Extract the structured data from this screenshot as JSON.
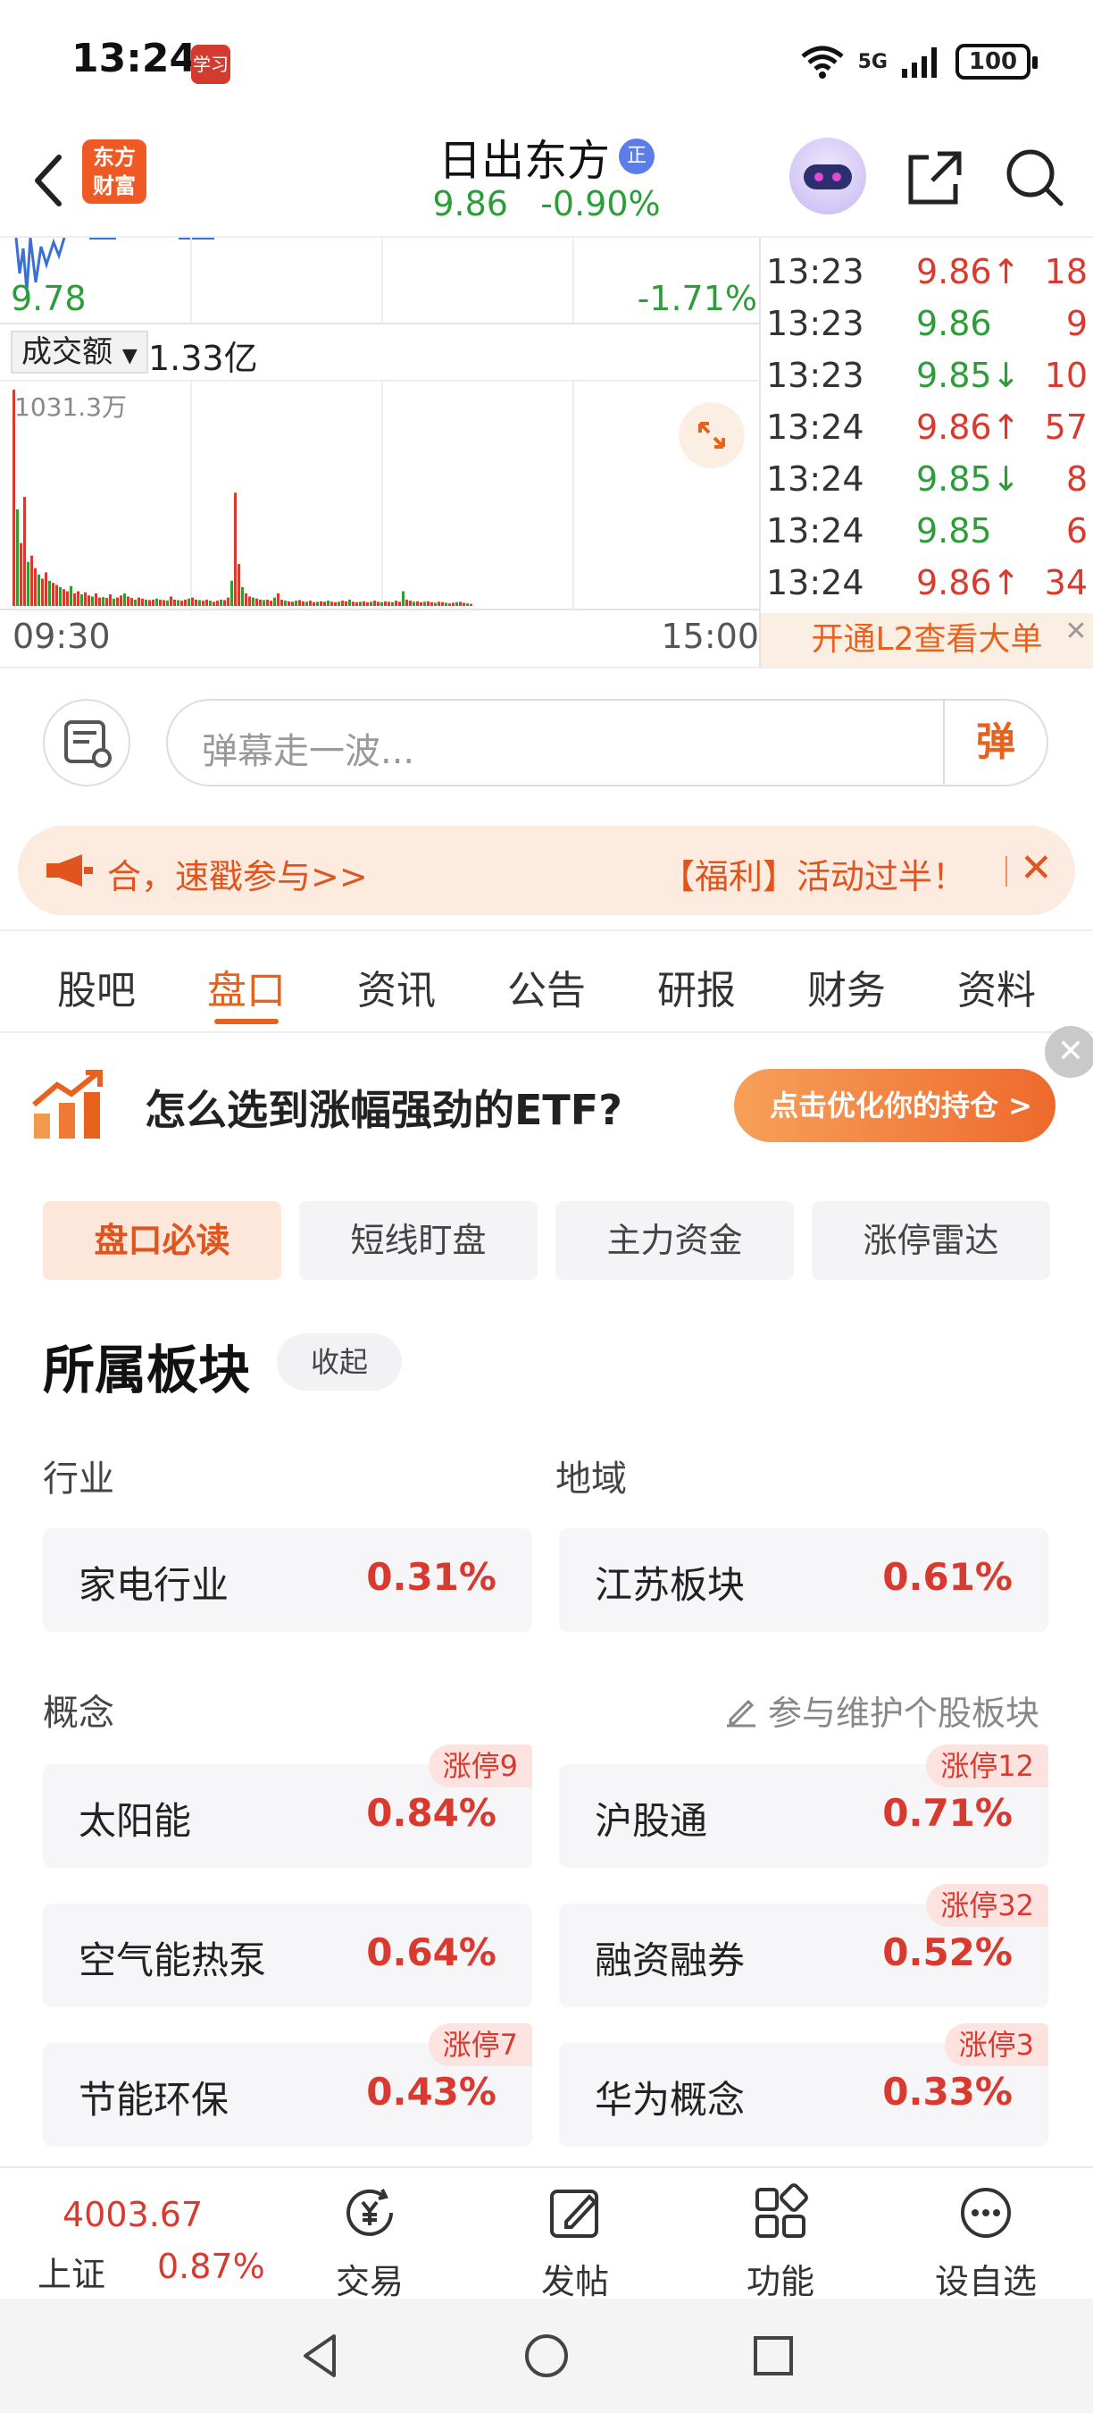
{
  "status_bar": {
    "time": "13:24",
    "app_icon_text": "学习",
    "network": "5G",
    "battery": "100"
  },
  "header": {
    "logo_line1": "东方",
    "logo_line2": "财富",
    "stock_name": "日出东方",
    "badge": "正",
    "price": "9.86",
    "change": "-0.90%"
  },
  "chart": {
    "price_low_label": "9.78",
    "pct_low_label": "-1.71%",
    "volume_selector": "成交额",
    "volume_total": "1.33亿",
    "volume_max_label": "1031.3万",
    "time_start": "09:30",
    "time_end": "15:00",
    "colors": {
      "up": "#d93a2f",
      "down": "#2d9d3a",
      "line": "#3b6fd6"
    }
  },
  "chart_data": {
    "type": "bar",
    "title": "",
    "ylabel": "",
    "max_value_label": "1031.3万",
    "ylim_wan": [
      0,
      1031.3
    ],
    "values_wan": [
      1031,
      460,
      300,
      520,
      210,
      240,
      180,
      150,
      130,
      160,
      120,
      110,
      100,
      90,
      80,
      70,
      95,
      60,
      70,
      55,
      65,
      50,
      45,
      60,
      40,
      42,
      38,
      55,
      35,
      40,
      50,
      60,
      45,
      38,
      30,
      40,
      35,
      30,
      28,
      30,
      35,
      30,
      28,
      26,
      45,
      30,
      28,
      25,
      30,
      35,
      40,
      30,
      28,
      25,
      30,
      25,
      20,
      25,
      30,
      28,
      40,
      120,
      540,
      200,
      90,
      60,
      45,
      40,
      35,
      30,
      28,
      30,
      25,
      40,
      60,
      30,
      25,
      22,
      20,
      25,
      28,
      22,
      20,
      25,
      18,
      20,
      22,
      20,
      25,
      20,
      18,
      20,
      25,
      22,
      30,
      20,
      18,
      20,
      22,
      18,
      20,
      25,
      20,
      18,
      22,
      20,
      18,
      25,
      20,
      70,
      30,
      25,
      20,
      22,
      18,
      20,
      22,
      18,
      15,
      20,
      18,
      15,
      12,
      15,
      18,
      20,
      15,
      12,
      10
    ]
  },
  "trades": [
    {
      "time": "13:23",
      "price": "9.86",
      "dir": "↑",
      "vol": "18",
      "cls": "up"
    },
    {
      "time": "13:23",
      "price": "9.86",
      "dir": "",
      "vol": "9",
      "cls": "flat"
    },
    {
      "time": "13:23",
      "price": "9.85",
      "dir": "↓",
      "vol": "10",
      "cls": "down"
    },
    {
      "time": "13:24",
      "price": "9.86",
      "dir": "↑",
      "vol": "57",
      "cls": "up"
    },
    {
      "time": "13:24",
      "price": "9.85",
      "dir": "↓",
      "vol": "8",
      "cls": "down"
    },
    {
      "time": "13:24",
      "price": "9.85",
      "dir": "",
      "vol": "6",
      "cls": "flat"
    },
    {
      "time": "13:24",
      "price": "9.86",
      "dir": "↑",
      "vol": "34",
      "cls": "up"
    }
  ],
  "l2_link": "开通L2查看大单",
  "danmu": {
    "placeholder": "弹幕走一波...",
    "button": "弹"
  },
  "notice": {
    "text1": "合，速戳参与>>",
    "text2": "【福利】活动过半！"
  },
  "tabs": [
    "股吧",
    "盘口",
    "资讯",
    "公告",
    "研报",
    "财务",
    "资料"
  ],
  "active_tab": 1,
  "etf_promo": {
    "text": "怎么选到涨幅强劲的ETF?",
    "button": "点击优化你的持仓 >"
  },
  "subtabs": [
    "盘口必读",
    "短线盯盘",
    "主力资金",
    "涨停雷达"
  ],
  "sector": {
    "title": "所属板块",
    "collapse": "收起",
    "industry_label": "行业",
    "region_label": "地域",
    "concept_label": "概念",
    "maintain_link": "参与维护个股板块",
    "industry": {
      "name": "家电行业",
      "pct": "0.31%"
    },
    "region": {
      "name": "江苏板块",
      "pct": "0.61%"
    },
    "concepts": [
      {
        "name": "太阳能",
        "pct": "0.84%",
        "tag": "涨停9"
      },
      {
        "name": "沪股通",
        "pct": "0.71%",
        "tag": "涨停12"
      },
      {
        "name": "空气能热泵",
        "pct": "0.64%",
        "tag": ""
      },
      {
        "name": "融资融券",
        "pct": "0.52%",
        "tag": "涨停32"
      },
      {
        "name": "节能环保",
        "pct": "0.43%",
        "tag": "涨停7"
      },
      {
        "name": "华为概念",
        "pct": "0.33%",
        "tag": "涨停3"
      }
    ]
  },
  "bottom_nav": {
    "index_value": "4003.67",
    "index_name": "上证",
    "index_pct": "0.87%",
    "items": [
      "交易",
      "发帖",
      "功能",
      "设自选"
    ]
  }
}
